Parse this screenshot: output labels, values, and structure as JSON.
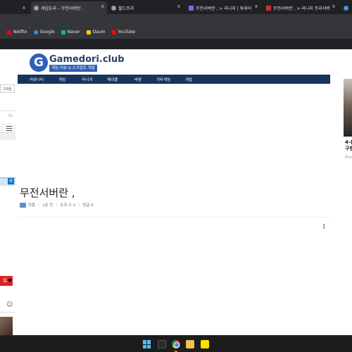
{
  "browser": {
    "tabs": [
      {
        "title": "게임도리 – 무전서버란 ,",
        "active": true
      },
      {
        "title": "월드프리",
        "active": false
      },
      {
        "title": "무전서버란 , > 리니지 | 투데이",
        "active": false
      },
      {
        "title": "무전서버란 , > 리니지 프리서버",
        "active": false
      }
    ],
    "tab_close": "x",
    "bookmarks": [
      {
        "label": "Netflix",
        "color": "#e50914"
      },
      {
        "label": "Google",
        "color": "#4285f4"
      },
      {
        "label": "Naver",
        "color": "#03c75a"
      },
      {
        "label": "Daum",
        "color": "#ffcd00"
      },
      {
        "label": "YouTube",
        "color": "#ff0000"
      }
    ]
  },
  "sidebar_left": {
    "box_label": "그라운",
    "small_text": "5%",
    "red_label": "트",
    "red_icon": "♥",
    "smile_icon": "☺",
    "close_icon": "✕"
  },
  "site": {
    "logo_letter": "G",
    "logo_text": "Gamedori.club",
    "logo_sub": "게임 리뷰 & 스크립트 개발",
    "nav": [
      "커뮤니티",
      "게임",
      "리니지",
      "메이플",
      "바람",
      "기타게임",
      "개발"
    ]
  },
  "post": {
    "title": "무전서버란 ,",
    "author": "장물",
    "time": "1분 전",
    "views": "조회 수 0",
    "comments": "댓글 0",
    "more_icon": "⋮"
  },
  "right_ad": {
    "title_line1": "4-(",
    "title_line2": "구현",
    "small": "Pick"
  },
  "colors": {
    "nav_bg": "#17345c",
    "logo_blue": "#2f5fb7",
    "taskbar_bg": "#1c1c1c"
  },
  "taskbar": {
    "icons": [
      "windows-start-icon",
      "terminal-icon",
      "chrome-icon",
      "file-explorer-icon",
      "kakaotalk-icon"
    ]
  }
}
